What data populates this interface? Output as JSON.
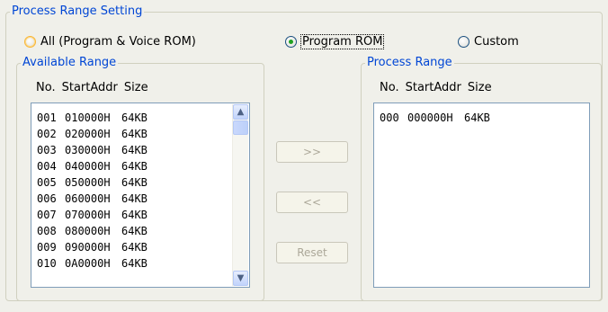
{
  "group": {
    "title": "Process Range Setting"
  },
  "mode_radios": [
    {
      "label": "All (Program & Voice ROM)",
      "selected": false
    },
    {
      "label": "Program ROM",
      "selected": true
    },
    {
      "label": "Custom",
      "selected": false
    }
  ],
  "available": {
    "title": "Available Range",
    "columns": [
      "No.",
      "StartAddr",
      "Size"
    ],
    "rows": [
      [
        "001",
        "010000H",
        "64KB"
      ],
      [
        "002",
        "020000H",
        "64KB"
      ],
      [
        "003",
        "030000H",
        "64KB"
      ],
      [
        "004",
        "040000H",
        "64KB"
      ],
      [
        "005",
        "050000H",
        "64KB"
      ],
      [
        "006",
        "060000H",
        "64KB"
      ],
      [
        "007",
        "070000H",
        "64KB"
      ],
      [
        "008",
        "080000H",
        "64KB"
      ],
      [
        "009",
        "090000H",
        "64KB"
      ],
      [
        "010",
        "0A0000H",
        "64KB"
      ]
    ]
  },
  "process": {
    "title": "Process Range",
    "columns": [
      "No.",
      "StartAddr",
      "Size"
    ],
    "rows": [
      [
        "000",
        "000000H",
        "64KB"
      ]
    ]
  },
  "buttons": {
    "add": ">>",
    "remove": "<<",
    "reset": "Reset"
  },
  "icons": {
    "scroll_up": "chevron-up-icon",
    "scroll_down": "chevron-down-icon"
  },
  "colors": {
    "group_title": "#0046d5",
    "radio_dot": "#21a121",
    "disabled_text": "#aca899"
  }
}
